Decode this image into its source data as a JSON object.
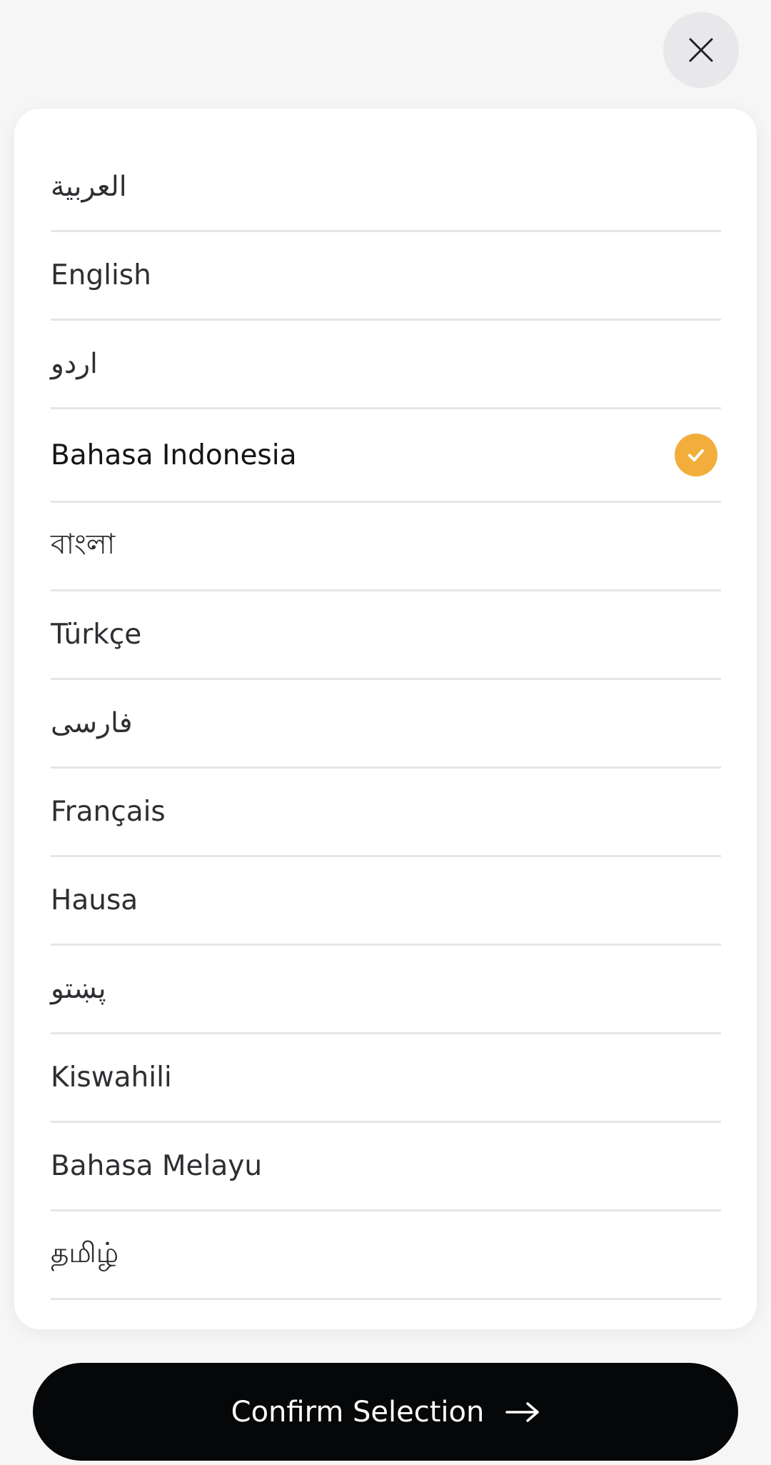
{
  "close": {
    "icon": "close-icon"
  },
  "languages": [
    {
      "label": "العربية",
      "selected": false
    },
    {
      "label": "English",
      "selected": false
    },
    {
      "label": "اردو",
      "selected": false
    },
    {
      "label": "Bahasa Indonesia",
      "selected": true
    },
    {
      "label": "বাংলা",
      "selected": false
    },
    {
      "label": "Türkçe",
      "selected": false
    },
    {
      "label": "فارسی",
      "selected": false
    },
    {
      "label": "Français",
      "selected": false
    },
    {
      "label": "Hausa",
      "selected": false
    },
    {
      "label": "پښتو",
      "selected": false
    },
    {
      "label": "Kiswahili",
      "selected": false
    },
    {
      "label": "Bahasa Melayu",
      "selected": false
    },
    {
      "label": "தமிழ்",
      "selected": false
    }
  ],
  "selected_icon": "check-icon",
  "confirm": {
    "label": "Confirm Selection",
    "icon": "arrow-right-icon"
  },
  "colors": {
    "background": "#f6f6f7",
    "card": "#ffffff",
    "accent": "#f2ae3b",
    "button": "#060708",
    "divider": "#e6e6e8"
  }
}
